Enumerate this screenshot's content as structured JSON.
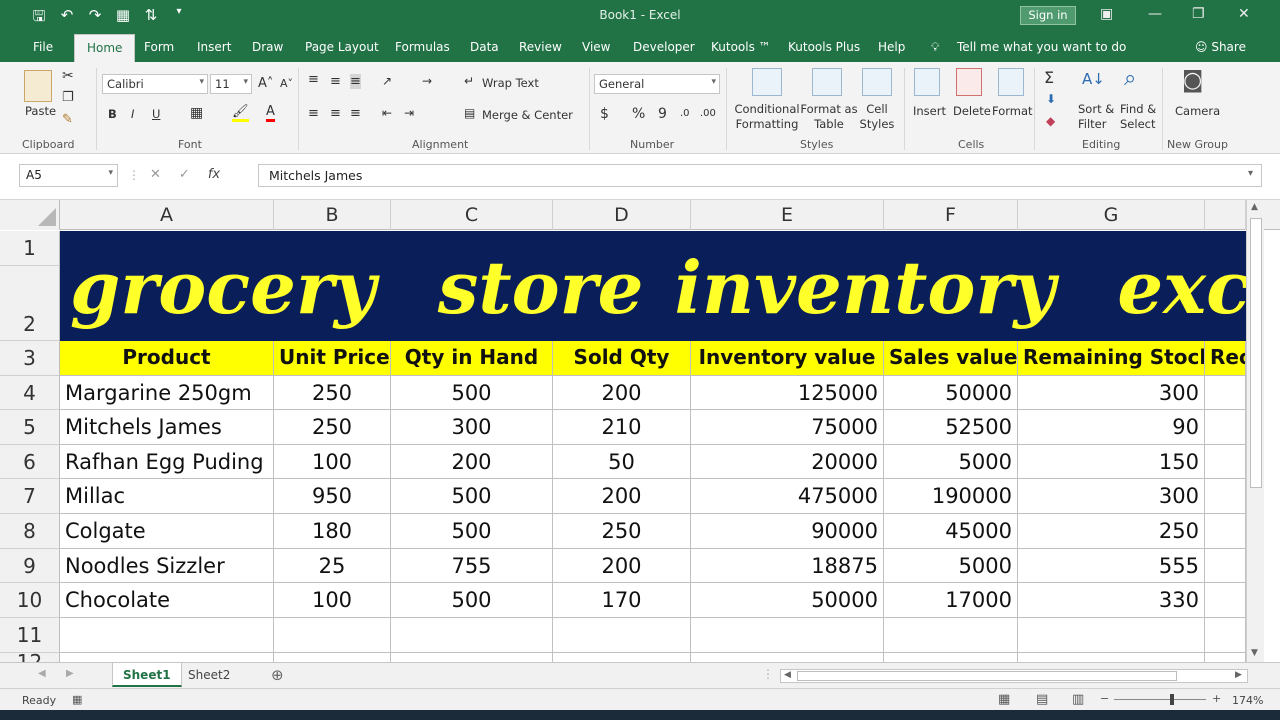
{
  "window": {
    "title": "Book1  -  Excel",
    "signin": "Sign in"
  },
  "qat": {
    "save_icon": "save-icon",
    "undo_icon": "undo-icon",
    "redo_icon": "redo-icon"
  },
  "menu": {
    "tabs": [
      "File",
      "Home",
      "Form",
      "Insert",
      "Draw",
      "Page Layout",
      "Formulas",
      "Data",
      "Review",
      "View",
      "Developer",
      "Kutools ™",
      "Kutools Plus",
      "Help"
    ],
    "active": "Home",
    "tell_me": "Tell me what you want to do",
    "share": "Share"
  },
  "ribbon": {
    "clipboard": {
      "label": "Clipboard",
      "paste": "Paste"
    },
    "font": {
      "label": "Font",
      "name": "Calibri",
      "size": "11",
      "bold": "B",
      "italic": "I",
      "underline": "U"
    },
    "alignment": {
      "label": "Alignment",
      "wrap": "Wrap Text",
      "merge": "Merge & Center"
    },
    "number": {
      "label": "Number",
      "format": "General",
      "currency": "$",
      "percent": "%",
      "comma": "9"
    },
    "styles": {
      "label": "Styles",
      "conditional": [
        "Conditional",
        "Formatting"
      ],
      "format_table": [
        "Format as",
        "Table"
      ],
      "cell_styles": [
        "Cell",
        "Styles"
      ]
    },
    "cells": {
      "label": "Cells",
      "insert": "Insert",
      "delete": "Delete",
      "format": "Format"
    },
    "editing": {
      "label": "Editing",
      "sort": [
        "Sort &",
        "Filter"
      ],
      "find": [
        "Find &",
        "Select"
      ]
    },
    "newgroup": {
      "label": "New Group",
      "camera": "Camera"
    }
  },
  "formula_bar": {
    "name_box": "A5",
    "fx": "fx",
    "content": "Mitchels James"
  },
  "sheet": {
    "columns": [
      "A",
      "B",
      "C",
      "D",
      "E",
      "F",
      "G"
    ],
    "rows": [
      "1",
      "2",
      "3",
      "4",
      "5",
      "6",
      "7",
      "8",
      "9",
      "10",
      "11",
      "12"
    ],
    "banner": "grocery  store inventory  excel",
    "headers": [
      "Product",
      "Unit Price",
      "Qty in Hand",
      "Sold Qty",
      "Inventory value",
      "Sales value",
      "Remaining Stock",
      "Reo"
    ],
    "data": [
      [
        "Margarine 250gm",
        "250",
        "500",
        "200",
        "125000",
        "50000",
        "300"
      ],
      [
        "Mitchels James",
        "250",
        "300",
        "210",
        "75000",
        "52500",
        "90"
      ],
      [
        "Rafhan  Egg Puding",
        "100",
        "200",
        "50",
        "20000",
        "5000",
        "150"
      ],
      [
        "Millac",
        "950",
        "500",
        "200",
        "475000",
        "190000",
        "300"
      ],
      [
        "Colgate",
        "180",
        "500",
        "250",
        "90000",
        "45000",
        "250"
      ],
      [
        "Noodles Sizzler",
        "25",
        "755",
        "200",
        "18875",
        "5000",
        "555"
      ],
      [
        "Chocolate",
        "100",
        "500",
        "170",
        "50000",
        "17000",
        "330"
      ]
    ]
  },
  "sheets": {
    "tabs": [
      "Sheet1",
      "Sheet2"
    ],
    "active": "Sheet1"
  },
  "status": {
    "ready": "Ready",
    "zoom": "174%"
  },
  "colors": {
    "excel_green": "#217346",
    "banner_bg": "#0a1e5a",
    "banner_text": "#ffff2a",
    "header_fill": "#ffff00"
  }
}
